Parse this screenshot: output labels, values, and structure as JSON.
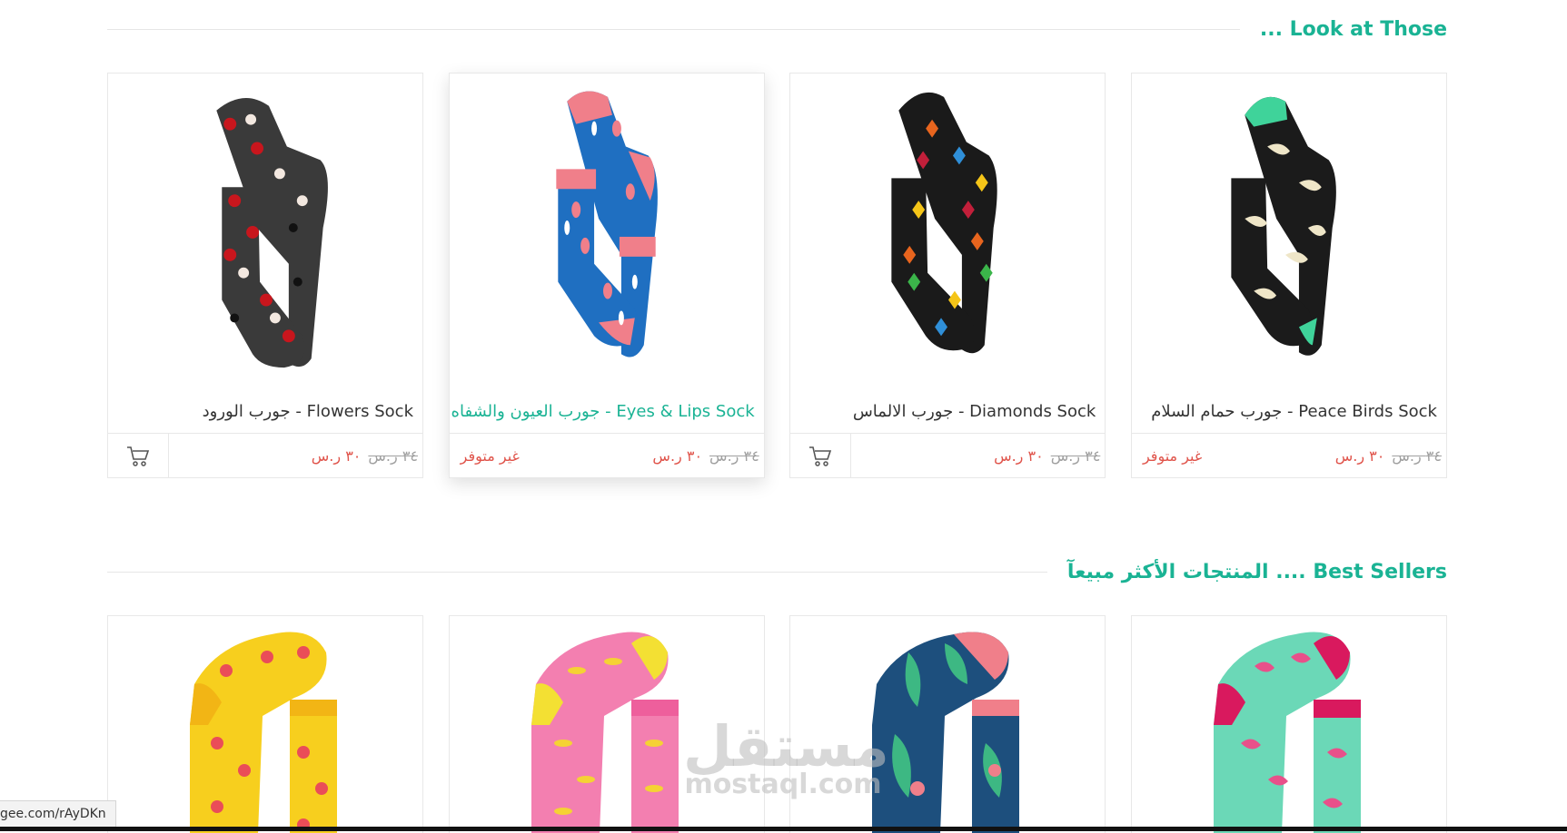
{
  "sections": [
    {
      "title": "Look at Those ...",
      "products": [
        {
          "name": "Flowers Sock - جورب الورود",
          "old_price": "٣٤ ر.س",
          "new_price": "٣٠ ر.س",
          "status": "",
          "cart_icon": "cart-icon"
        },
        {
          "name": "Eyes & Lips Sock - جورب العيون والشفاه",
          "old_price": "٣٤ ر.س",
          "new_price": "٣٠ ر.س",
          "status": "غير متوفر"
        },
        {
          "name": "Diamonds Sock - جورب الالماس",
          "old_price": "٣٤ ر.س",
          "new_price": "٣٠ ر.س",
          "status": "",
          "cart_icon": "cart-icon"
        },
        {
          "name": "Peace Birds Sock - جورب حمام السلام",
          "old_price": "٣٤ ر.س",
          "new_price": "٣٠ ر.س",
          "status": "غير متوفر"
        }
      ]
    },
    {
      "title": "Best Sellers .... المنتجات الأكثر مبيعآ"
    }
  ],
  "watermark": {
    "arabic": "مستقل",
    "latin": "mostaql.com"
  },
  "status_bar": {
    "url": "gee.com/rAyDKn"
  },
  "colors": {
    "accent": "#1ab394",
    "price": "#e0544b",
    "old_price": "#a0a0a0"
  }
}
